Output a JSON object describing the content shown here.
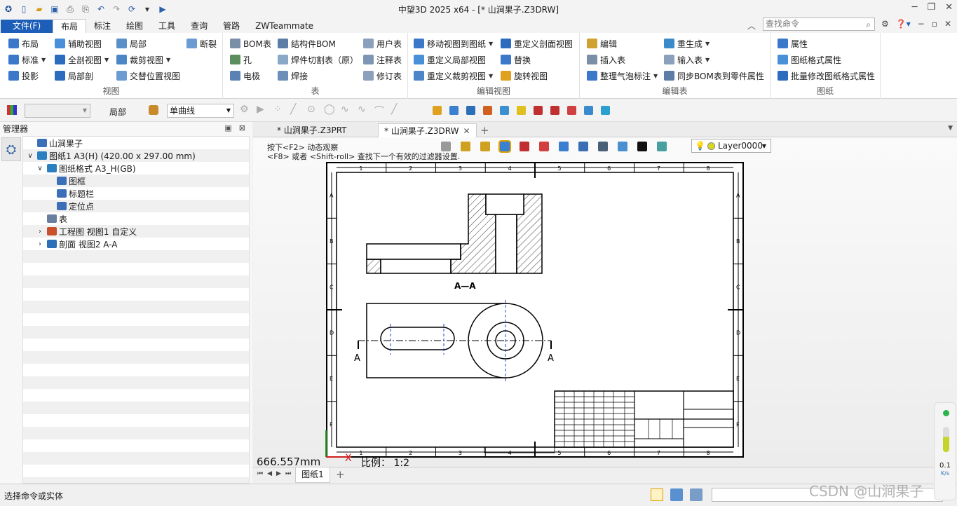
{
  "app": {
    "title": "中望3D 2025 x64 - [* 山涧果子.Z3DRW]",
    "window_controls": [
      "─",
      "❐",
      "✕"
    ]
  },
  "menu": {
    "file": "文件(F)",
    "tabs": [
      "布局",
      "标注",
      "绘图",
      "工具",
      "查询",
      "管路",
      "ZWTeammate"
    ],
    "active": "布局",
    "search_placeholder": "查找命令"
  },
  "ribbon": {
    "view": {
      "label": "视图",
      "buttons": [
        "布局",
        "辅助视图",
        "局部",
        "断裂",
        "标准",
        "全剖视图",
        "裁剪视图",
        "投影",
        "局部剖",
        "交替位置视图"
      ]
    },
    "table": {
      "label": "表",
      "buttons": [
        "BOM表",
        "结构件BOM",
        "用户表",
        "孔",
        "焊件切割表（原）",
        "注释表",
        "电极",
        "焊接",
        "修订表"
      ]
    },
    "edit_view": {
      "label": "编辑视图",
      "buttons": [
        "移动视图到图纸",
        "重定义剖面视图",
        "重定义局部视图",
        "替换",
        "重定义裁剪视图",
        "旋转视图"
      ]
    },
    "edit_table": {
      "label": "编辑表",
      "buttons": [
        "编辑",
        "重生成",
        "插入表",
        "输入表",
        "整理气泡标注",
        "同步BOM表到零件属性"
      ]
    },
    "sheet": {
      "label": "图纸",
      "buttons": [
        "属性",
        "图纸格式属性",
        "批量修改图纸格式属性"
      ]
    }
  },
  "toolbar2": {
    "filter_value": "",
    "local_label": "局部",
    "curve_type": "单曲线"
  },
  "manager": {
    "title": "管理器",
    "tree": [
      {
        "label": "山涧果子",
        "level": 0,
        "chev": ""
      },
      {
        "label": "图纸1 A3(H) (420.00 x 297.00 mm)",
        "level": 0,
        "chev": "∨"
      },
      {
        "label": "图纸格式 A3_H(GB)",
        "level": 1,
        "chev": "∨"
      },
      {
        "label": "图框",
        "level": 2,
        "chev": ""
      },
      {
        "label": "标题栏",
        "level": 2,
        "chev": ""
      },
      {
        "label": "定位点",
        "level": 2,
        "chev": ""
      },
      {
        "label": "表",
        "level": 1,
        "chev": ""
      },
      {
        "label": "工程图 视图1 自定义",
        "level": 1,
        "chev": "›"
      },
      {
        "label": "剖面 视图2 A-A",
        "level": 1,
        "chev": "›"
      }
    ]
  },
  "docs": {
    "tabs": [
      "* 山涧果子.Z3PRT",
      "* 山涧果子.Z3DRW"
    ],
    "active": 1
  },
  "canvas": {
    "hint1": "按下<F2> 动态观察",
    "hint2": "<F8> 或者 <Shift-roll> 查找下一个有效的过滤器设置.",
    "layer": "Layer0000",
    "section_label": "A—A",
    "cut_label_left": "A",
    "cut_label_right": "A",
    "measure": "666.557mm",
    "scale": "比例：  1:2",
    "col_numbers": [
      "1",
      "2",
      "3",
      "4",
      "5",
      "6",
      "7",
      "8"
    ],
    "row_letters": [
      "A",
      "B",
      "C",
      "D",
      "E",
      "F"
    ]
  },
  "sheet_tab": "图纸1",
  "status": {
    "prompt": "选择命令或实体"
  },
  "gauge": {
    "value": "0.1",
    "unit": "K/s"
  },
  "watermark": "CSDN @山涧果子"
}
